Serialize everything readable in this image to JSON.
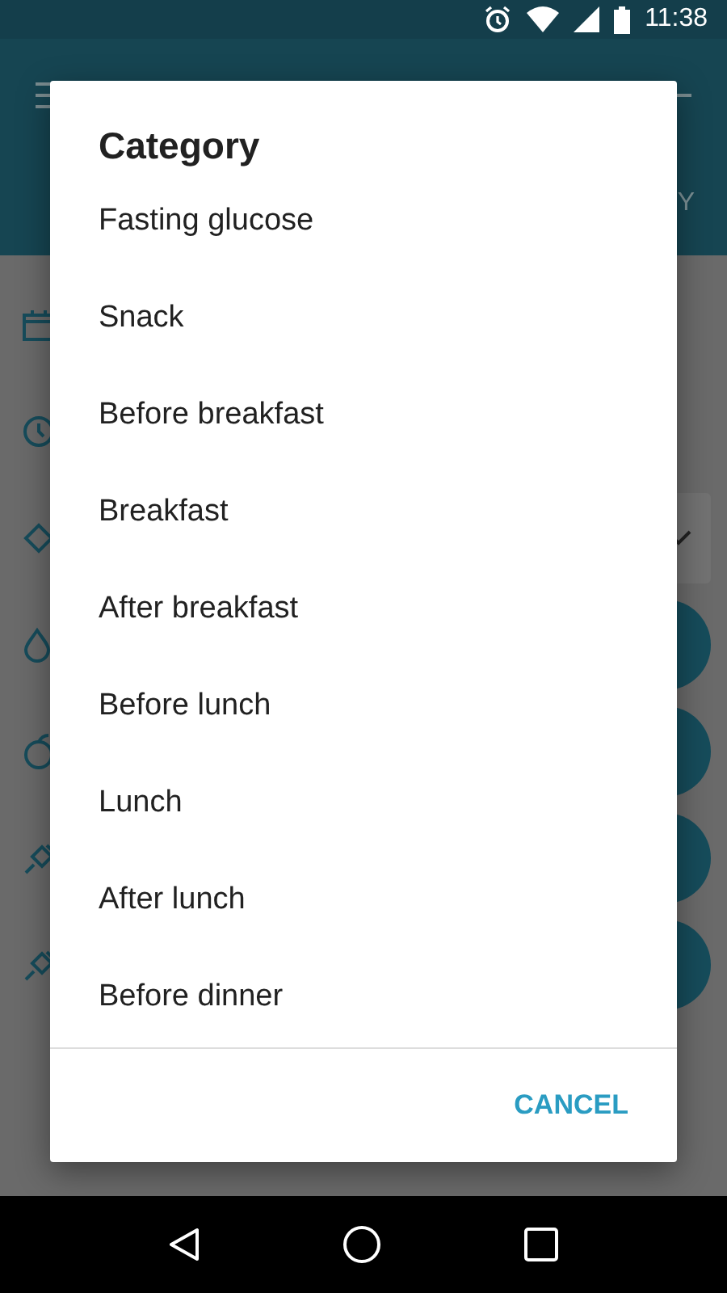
{
  "status_bar": {
    "time": "11:38"
  },
  "app_bar": {
    "tab_fragment": "Y"
  },
  "form": {
    "checked": true
  },
  "dialog": {
    "title": "Category",
    "items": [
      {
        "label": "Fasting glucose"
      },
      {
        "label": "Snack"
      },
      {
        "label": "Before breakfast"
      },
      {
        "label": "Breakfast"
      },
      {
        "label": "After breakfast"
      },
      {
        "label": "Before lunch"
      },
      {
        "label": "Lunch"
      },
      {
        "label": "After lunch"
      },
      {
        "label": "Before dinner"
      }
    ],
    "buttons": [
      "CANCEL"
    ]
  }
}
